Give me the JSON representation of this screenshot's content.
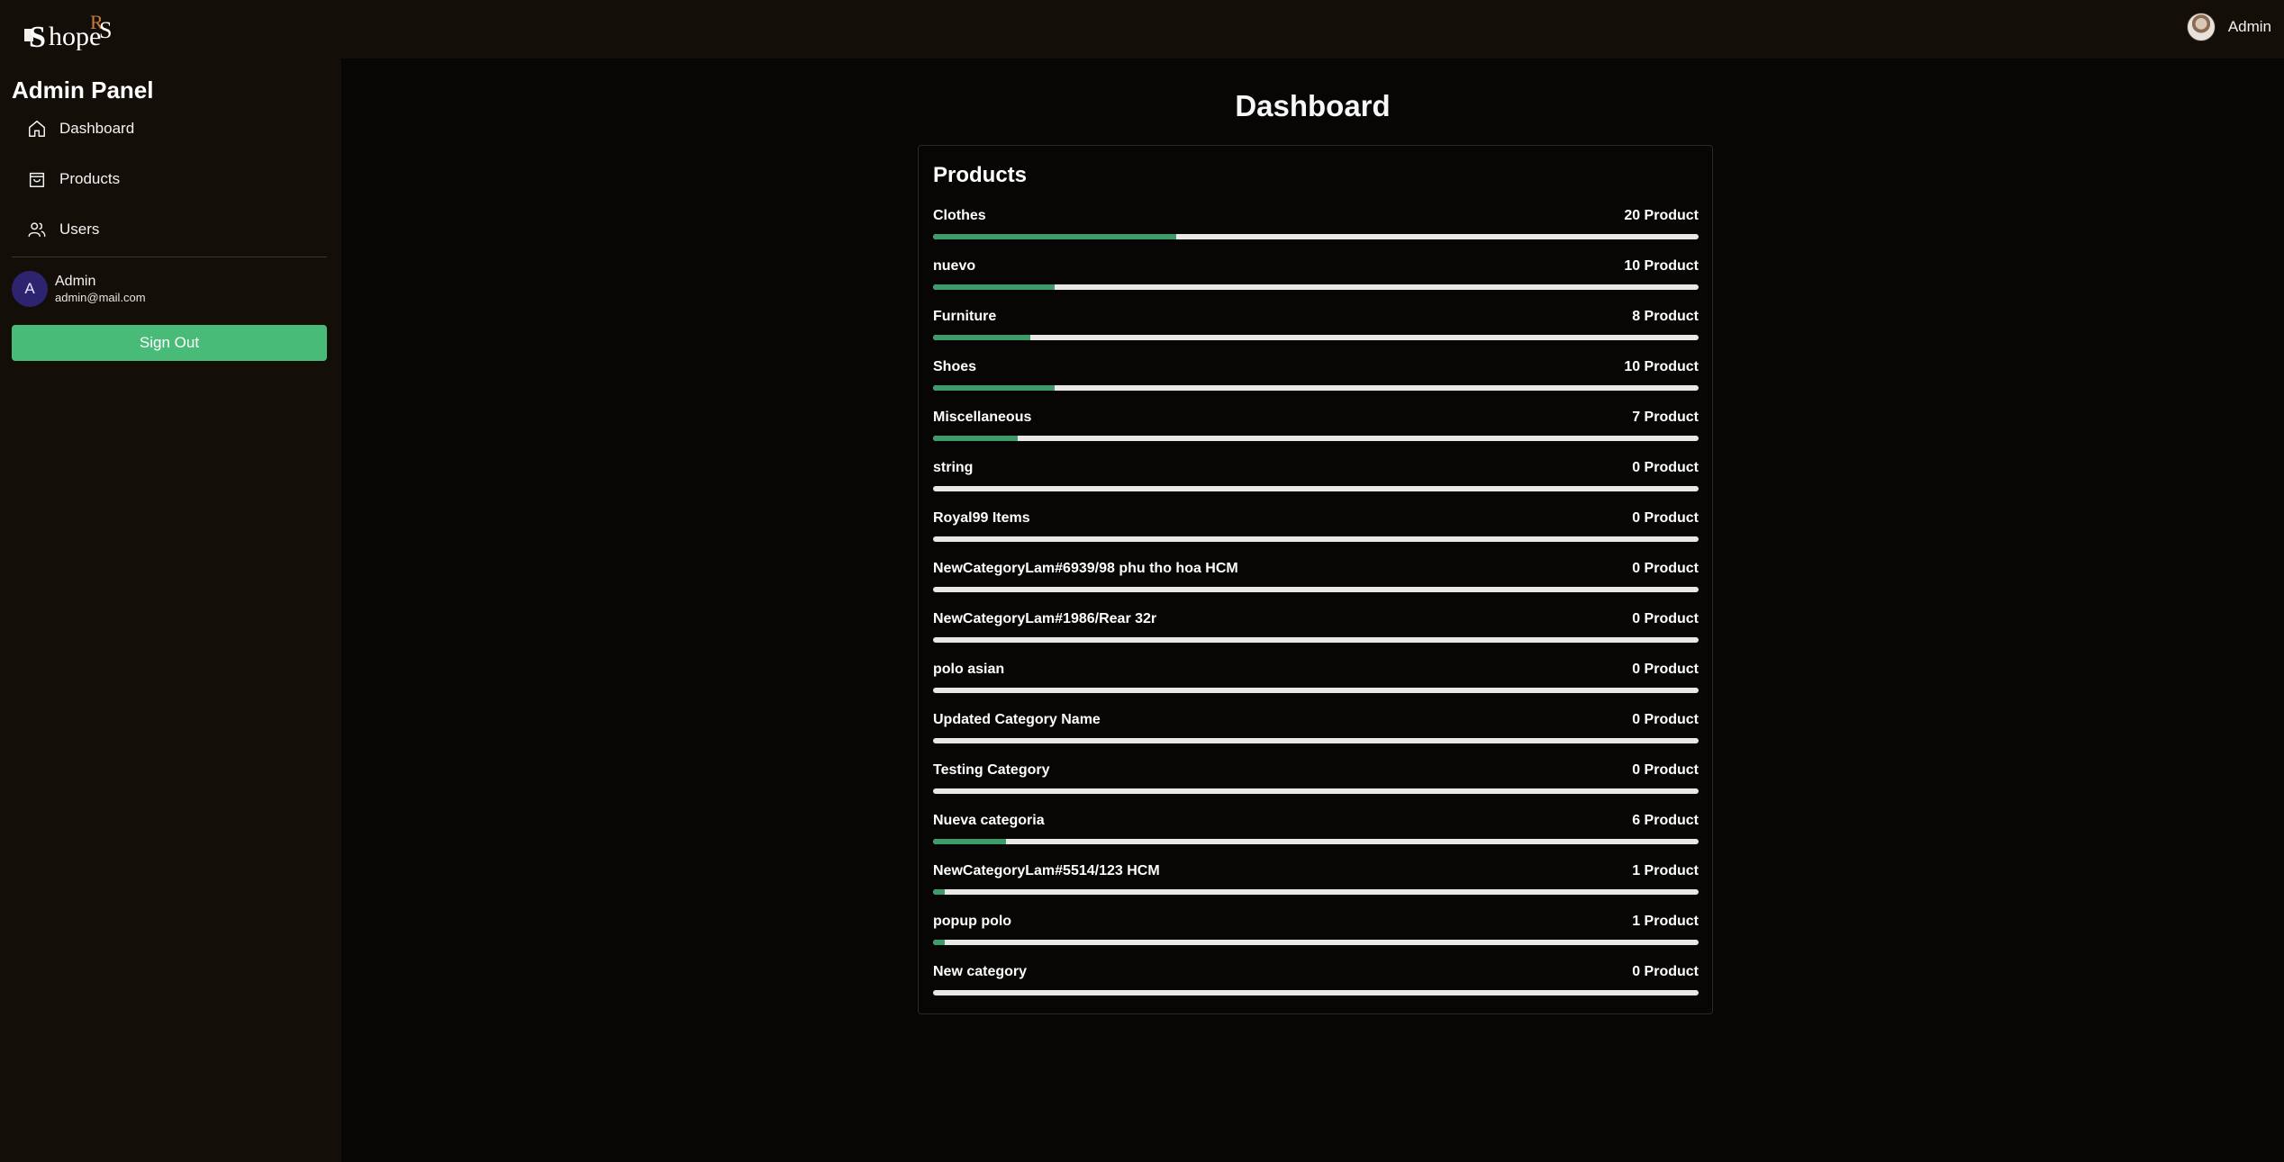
{
  "header": {
    "logo_text": "ShopeRS",
    "user_name": "Admin"
  },
  "sidebar": {
    "title": "Admin Panel",
    "items": [
      {
        "label": "Dashboard",
        "icon": "home-icon"
      },
      {
        "label": "Products",
        "icon": "shopping-bag-icon"
      },
      {
        "label": "Users",
        "icon": "users-icon"
      }
    ],
    "profile": {
      "initial": "A",
      "name": "Admin",
      "email": "admin@mail.com"
    },
    "signout_label": "Sign Out"
  },
  "main": {
    "title": "Dashboard",
    "card_title": "Products",
    "max_count": 63,
    "categories": [
      {
        "name": "Clothes",
        "count": 20,
        "label": "20 Product"
      },
      {
        "name": "nuevo",
        "count": 10,
        "label": "10 Product"
      },
      {
        "name": "Furniture",
        "count": 8,
        "label": "8 Product"
      },
      {
        "name": "Shoes",
        "count": 10,
        "label": "10 Product"
      },
      {
        "name": "Miscellaneous",
        "count": 7,
        "label": "7 Product"
      },
      {
        "name": "string",
        "count": 0,
        "label": "0 Product"
      },
      {
        "name": "Royal99 Items",
        "count": 0,
        "label": "0 Product"
      },
      {
        "name": "NewCategoryLam#6939/98 phu tho hoa HCM",
        "count": 0,
        "label": "0 Product"
      },
      {
        "name": "NewCategoryLam#1986/Rear 32r",
        "count": 0,
        "label": "0 Product"
      },
      {
        "name": "polo asian",
        "count": 0,
        "label": "0 Product"
      },
      {
        "name": "Updated Category Name",
        "count": 0,
        "label": "0 Product"
      },
      {
        "name": "Testing Category",
        "count": 0,
        "label": "0 Product"
      },
      {
        "name": "Nueva categoria",
        "count": 6,
        "label": "6 Product"
      },
      {
        "name": "NewCategoryLam#5514/123 HCM",
        "count": 1,
        "label": "1 Product"
      },
      {
        "name": "popup polo",
        "count": 1,
        "label": "1 Product"
      },
      {
        "name": "New category",
        "count": 0,
        "label": "0 Product"
      }
    ]
  },
  "colors": {
    "bar_fill": "#3f9b6a",
    "bar_track": "#e8e8e8",
    "signout": "#48bb78",
    "sidebar_bg": "#140e08",
    "main_bg": "#070605"
  }
}
